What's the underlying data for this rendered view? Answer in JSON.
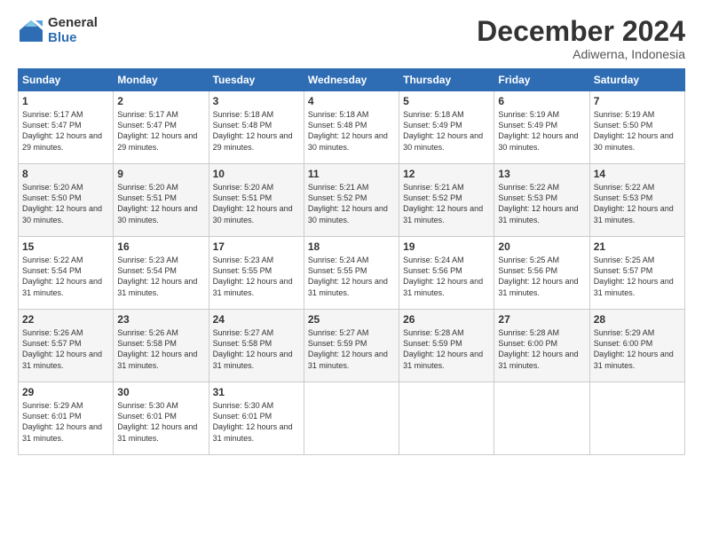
{
  "header": {
    "logo_general": "General",
    "logo_blue": "Blue",
    "month_title": "December 2024",
    "location": "Adiwerna, Indonesia"
  },
  "weekdays": [
    "Sunday",
    "Monday",
    "Tuesday",
    "Wednesday",
    "Thursday",
    "Friday",
    "Saturday"
  ],
  "weeks": [
    [
      {
        "day": "1",
        "rise": "5:17 AM",
        "set": "5:47 PM",
        "daylight": "12 hours and 29 minutes."
      },
      {
        "day": "2",
        "rise": "5:17 AM",
        "set": "5:47 PM",
        "daylight": "12 hours and 29 minutes."
      },
      {
        "day": "3",
        "rise": "5:18 AM",
        "set": "5:48 PM",
        "daylight": "12 hours and 29 minutes."
      },
      {
        "day": "4",
        "rise": "5:18 AM",
        "set": "5:48 PM",
        "daylight": "12 hours and 30 minutes."
      },
      {
        "day": "5",
        "rise": "5:18 AM",
        "set": "5:49 PM",
        "daylight": "12 hours and 30 minutes."
      },
      {
        "day": "6",
        "rise": "5:19 AM",
        "set": "5:49 PM",
        "daylight": "12 hours and 30 minutes."
      },
      {
        "day": "7",
        "rise": "5:19 AM",
        "set": "5:50 PM",
        "daylight": "12 hours and 30 minutes."
      }
    ],
    [
      {
        "day": "8",
        "rise": "5:20 AM",
        "set": "5:50 PM",
        "daylight": "12 hours and 30 minutes."
      },
      {
        "day": "9",
        "rise": "5:20 AM",
        "set": "5:51 PM",
        "daylight": "12 hours and 30 minutes."
      },
      {
        "day": "10",
        "rise": "5:20 AM",
        "set": "5:51 PM",
        "daylight": "12 hours and 30 minutes."
      },
      {
        "day": "11",
        "rise": "5:21 AM",
        "set": "5:52 PM",
        "daylight": "12 hours and 30 minutes."
      },
      {
        "day": "12",
        "rise": "5:21 AM",
        "set": "5:52 PM",
        "daylight": "12 hours and 31 minutes."
      },
      {
        "day": "13",
        "rise": "5:22 AM",
        "set": "5:53 PM",
        "daylight": "12 hours and 31 minutes."
      },
      {
        "day": "14",
        "rise": "5:22 AM",
        "set": "5:53 PM",
        "daylight": "12 hours and 31 minutes."
      }
    ],
    [
      {
        "day": "15",
        "rise": "5:22 AM",
        "set": "5:54 PM",
        "daylight": "12 hours and 31 minutes."
      },
      {
        "day": "16",
        "rise": "5:23 AM",
        "set": "5:54 PM",
        "daylight": "12 hours and 31 minutes."
      },
      {
        "day": "17",
        "rise": "5:23 AM",
        "set": "5:55 PM",
        "daylight": "12 hours and 31 minutes."
      },
      {
        "day": "18",
        "rise": "5:24 AM",
        "set": "5:55 PM",
        "daylight": "12 hours and 31 minutes."
      },
      {
        "day": "19",
        "rise": "5:24 AM",
        "set": "5:56 PM",
        "daylight": "12 hours and 31 minutes."
      },
      {
        "day": "20",
        "rise": "5:25 AM",
        "set": "5:56 PM",
        "daylight": "12 hours and 31 minutes."
      },
      {
        "day": "21",
        "rise": "5:25 AM",
        "set": "5:57 PM",
        "daylight": "12 hours and 31 minutes."
      }
    ],
    [
      {
        "day": "22",
        "rise": "5:26 AM",
        "set": "5:57 PM",
        "daylight": "12 hours and 31 minutes."
      },
      {
        "day": "23",
        "rise": "5:26 AM",
        "set": "5:58 PM",
        "daylight": "12 hours and 31 minutes."
      },
      {
        "day": "24",
        "rise": "5:27 AM",
        "set": "5:58 PM",
        "daylight": "12 hours and 31 minutes."
      },
      {
        "day": "25",
        "rise": "5:27 AM",
        "set": "5:59 PM",
        "daylight": "12 hours and 31 minutes."
      },
      {
        "day": "26",
        "rise": "5:28 AM",
        "set": "5:59 PM",
        "daylight": "12 hours and 31 minutes."
      },
      {
        "day": "27",
        "rise": "5:28 AM",
        "set": "6:00 PM",
        "daylight": "12 hours and 31 minutes."
      },
      {
        "day": "28",
        "rise": "5:29 AM",
        "set": "6:00 PM",
        "daylight": "12 hours and 31 minutes."
      }
    ],
    [
      {
        "day": "29",
        "rise": "5:29 AM",
        "set": "6:01 PM",
        "daylight": "12 hours and 31 minutes."
      },
      {
        "day": "30",
        "rise": "5:30 AM",
        "set": "6:01 PM",
        "daylight": "12 hours and 31 minutes."
      },
      {
        "day": "31",
        "rise": "5:30 AM",
        "set": "6:01 PM",
        "daylight": "12 hours and 31 minutes."
      },
      null,
      null,
      null,
      null
    ]
  ]
}
